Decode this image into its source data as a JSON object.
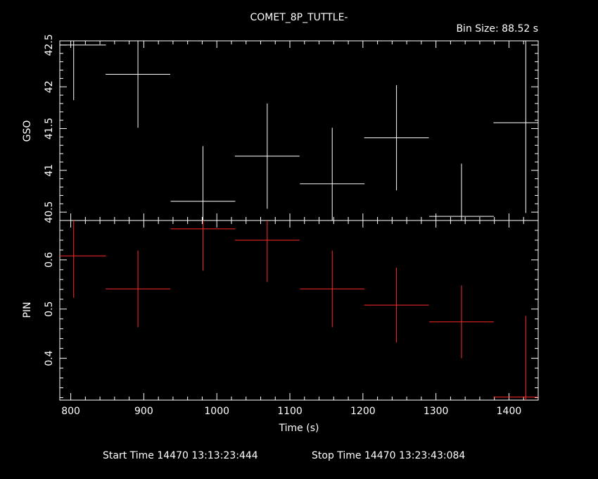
{
  "title": "COMET_8P_TUTTLE-",
  "bin_size_label": "Bin Size: 88.52 s",
  "footer": {
    "start": "Start Time 14470 13:13:23:444",
    "stop": "Stop Time 14470 13:23:43:084"
  },
  "colors": {
    "background": "#000000",
    "axes": "#ffffff",
    "gso": "#ffffff",
    "pin": "#ff2a2a"
  },
  "chart_data": [
    {
      "type": "scatter",
      "panel": "top",
      "title": "COMET_8P_TUTTLE-",
      "ylabel": "GSO",
      "xlim": [
        785,
        1440
      ],
      "ylim": [
        40.4,
        42.55
      ],
      "ytick_labels": [
        "40.5",
        "41",
        "41.5",
        "42",
        "42.5"
      ],
      "yticks": [
        40.5,
        41,
        41.5,
        42,
        42.5
      ],
      "grid": false,
      "series": [
        {
          "points": [
            {
              "x": 804,
              "xerr": 44.26,
              "y": 42.5,
              "yerr": 0.66
            },
            {
              "x": 892,
              "xerr": 44.26,
              "y": 42.15,
              "yerr": 0.64
            },
            {
              "x": 981,
              "xerr": 44.26,
              "y": 40.63,
              "yerr": 0.66
            },
            {
              "x": 1069,
              "xerr": 44.26,
              "y": 41.17,
              "yerr": 0.63
            },
            {
              "x": 1158,
              "xerr": 44.26,
              "y": 40.84,
              "yerr": 0.67
            },
            {
              "x": 1246,
              "xerr": 44.26,
              "y": 41.39,
              "yerr": 0.63
            },
            {
              "x": 1335,
              "xerr": 44.26,
              "y": 40.45,
              "yerr": 0.63
            },
            {
              "x": 1423,
              "xerr": 44.26,
              "y": 41.57,
              "yerr": 1.08
            }
          ]
        }
      ]
    },
    {
      "type": "scatter",
      "panel": "bottom",
      "xlabel": "Time (s)",
      "ylabel": "PIN",
      "xlim": [
        785,
        1440
      ],
      "ylim": [
        0.315,
        0.68
      ],
      "xticks": [
        800,
        900,
        1000,
        1100,
        1200,
        1300,
        1400
      ],
      "xtick_labels": [
        "800",
        "900",
        "1000",
        "1100",
        "1200",
        "1300",
        "1400"
      ],
      "yticks": [
        0.4,
        0.5,
        0.6
      ],
      "ytick_labels": [
        "0.4",
        "0.5",
        "0.6"
      ],
      "grid": false,
      "series": [
        {
          "points": [
            {
              "x": 804,
              "xerr": 44.26,
              "y": 0.608,
              "yerr": 0.085
            },
            {
              "x": 892,
              "xerr": 44.26,
              "y": 0.541,
              "yerr": 0.078
            },
            {
              "x": 981,
              "xerr": 44.26,
              "y": 0.663,
              "yerr": 0.085
            },
            {
              "x": 1069,
              "xerr": 44.26,
              "y": 0.64,
              "yerr": 0.085
            },
            {
              "x": 1158,
              "xerr": 44.26,
              "y": 0.541,
              "yerr": 0.078
            },
            {
              "x": 1246,
              "xerr": 44.26,
              "y": 0.508,
              "yerr": 0.076
            },
            {
              "x": 1335,
              "xerr": 44.26,
              "y": 0.474,
              "yerr": 0.074
            },
            {
              "x": 1423,
              "xerr": 44.26,
              "y": 0.321,
              "yerr": 0.165
            }
          ]
        }
      ]
    }
  ]
}
